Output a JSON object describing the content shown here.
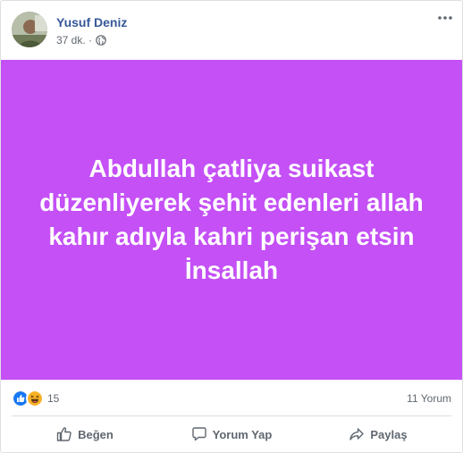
{
  "post": {
    "author_name": "Yusuf Deniz",
    "timestamp": "37 dk. ·",
    "privacy_icon": "globe-icon",
    "text": "Abdullah çatliya suikast düzenliyerek şehit edenleri allah kahır adıyla kahri perişan etsin İnsallah",
    "background_color": "#c450f6",
    "text_color": "#ffffff"
  },
  "stats": {
    "reaction_icons": [
      "like-icon",
      "haha-icon"
    ],
    "reaction_count": "15",
    "comments_count": "11 Yorum"
  },
  "actions": {
    "like_label": "Beğen",
    "comment_label": "Yorum Yap",
    "share_label": "Paylaş"
  },
  "colors": {
    "author_link": "#365899",
    "meta_text": "#616770",
    "action_text": "#606770",
    "like_blue": "#1877f2",
    "haha_yellow": "#f7b125"
  }
}
